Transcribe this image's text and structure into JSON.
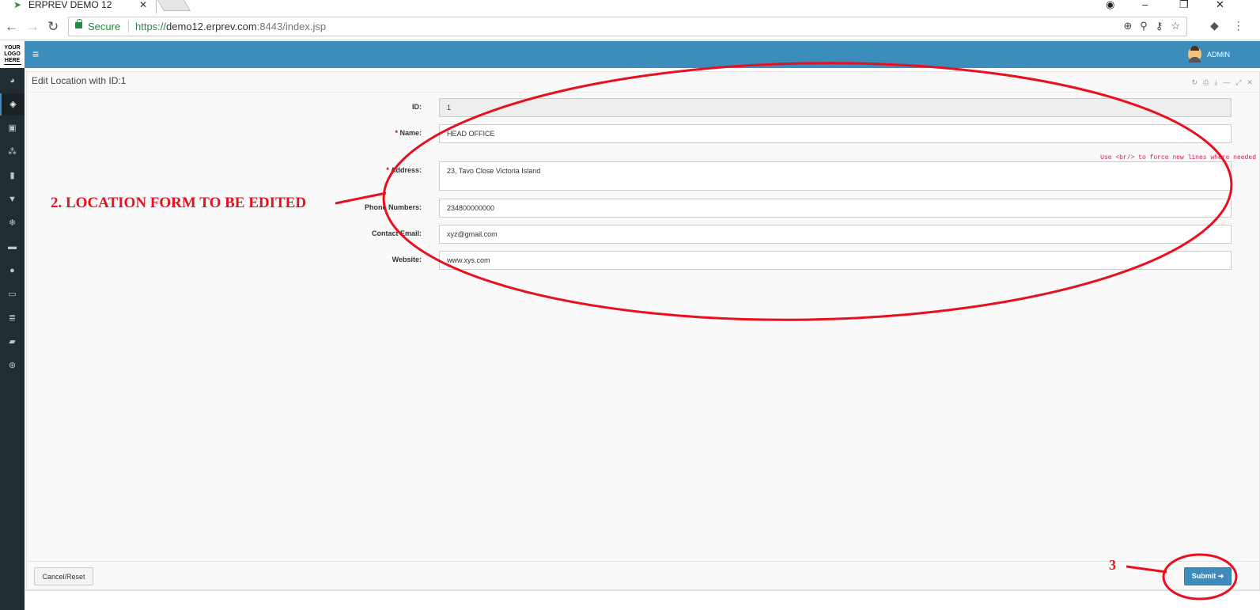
{
  "browser": {
    "tab_title": "ERPREV DEMO 12",
    "tab_close": "✕",
    "secure_label": "Secure",
    "url_scheme": "https://",
    "url_host": "demo12.erprev.com",
    "url_path": ":8443/index.jsp"
  },
  "sidebar": {
    "logo_lines": [
      "YOUR",
      "LOGO",
      "HERE"
    ],
    "items": [
      {
        "icon": "dashboard-icon"
      },
      {
        "icon": "tag-icon"
      },
      {
        "icon": "money-icon"
      },
      {
        "icon": "cubes-icon"
      },
      {
        "icon": "building-icon"
      },
      {
        "icon": "trash-icon"
      },
      {
        "icon": "snowflake-icon"
      },
      {
        "icon": "cart-icon"
      },
      {
        "icon": "hdd-icon"
      },
      {
        "icon": "desktop-icon"
      },
      {
        "icon": "database-icon"
      },
      {
        "icon": "book-icon"
      },
      {
        "icon": "support-icon"
      }
    ]
  },
  "topbar": {
    "user_label": "ADMIN"
  },
  "panel": {
    "title": "Edit Location with ID:1"
  },
  "form": {
    "id_label": "ID:",
    "id_value": "1",
    "name_label": "Name:",
    "name_value": "HEAD OFFICE",
    "address_hint": "Use <br/> to force new lines where needed",
    "address_label": "Address:",
    "address_value": "23, Tavo Close Victoria Island",
    "phone_label": "Phone Numbers:",
    "phone_value": "234800000000",
    "email_label": "Contact Email:",
    "email_value": "xyz@gmail.com",
    "website_label": "Website:",
    "website_value": "www.xys.com",
    "cancel_label": "Cancel/Reset",
    "submit_label": "Submit"
  },
  "annotations": {
    "note2": "2.   LOCATION FORM TO BE EDITED",
    "note3": "3",
    "color": "#e8101e"
  }
}
